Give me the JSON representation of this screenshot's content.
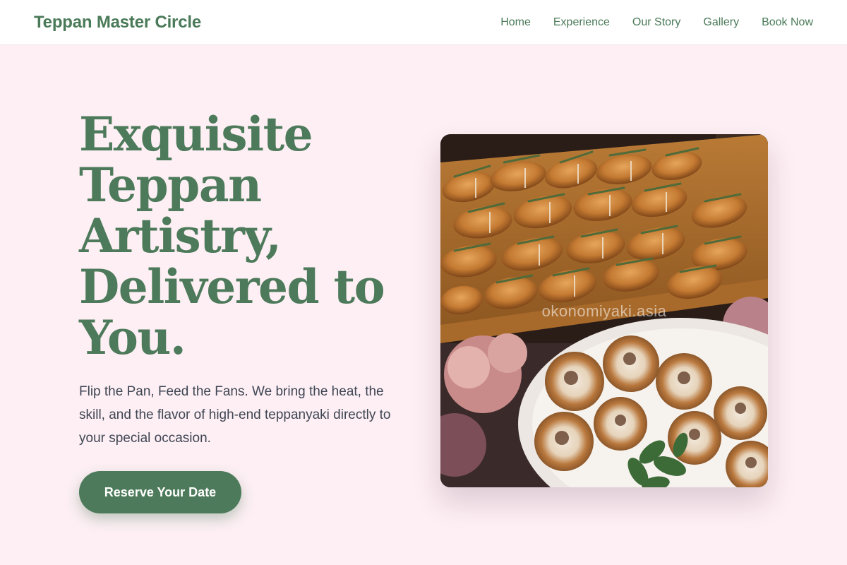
{
  "navbar": {
    "brand": "Teppan Master Circle",
    "links": [
      "Home",
      "Experience",
      "Our Story",
      "Gallery",
      "Book Now"
    ]
  },
  "hero": {
    "title": "Exquisite Teppan Artistry, Delivered to You.",
    "subtitle": "Flip the Pan, Feed the Fans. We bring the heat, the skill, and the flavor of high-end teppanyaki directly to your special occasion.",
    "cta_label": "Reserve Your Date",
    "image_watermark": "okonomiyaki.asia"
  },
  "colors": {
    "brand_green": "#4d7a5a",
    "page_background": "#fdeff4",
    "body_text": "#3f4653"
  }
}
